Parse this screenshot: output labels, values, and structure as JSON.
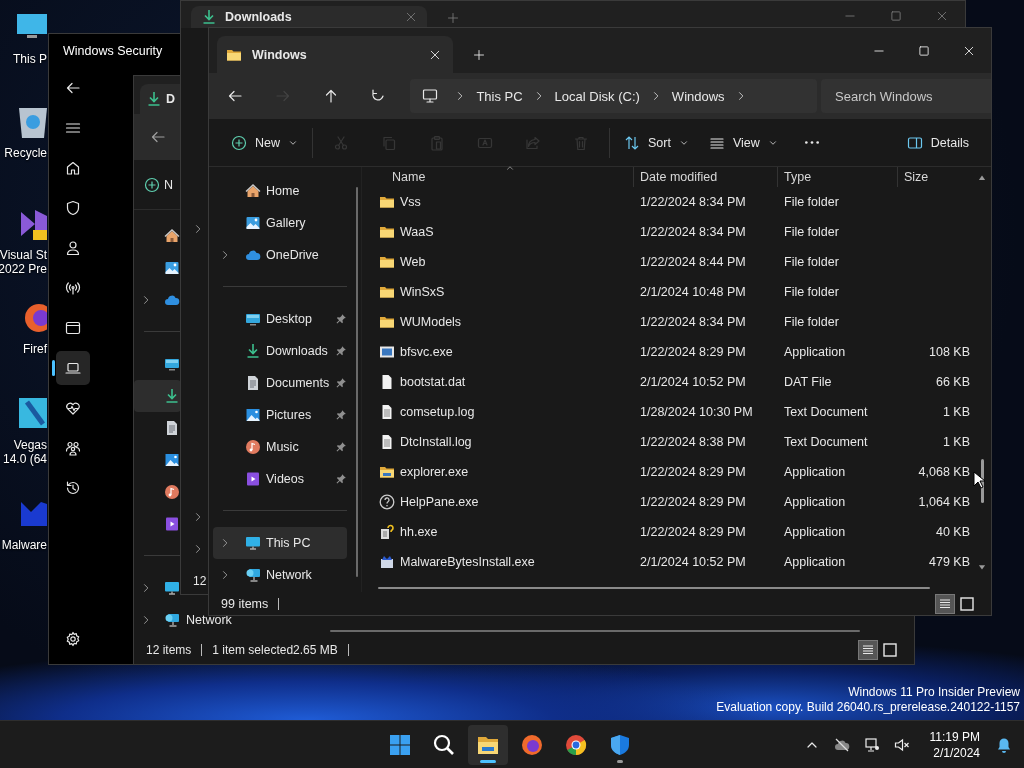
{
  "desktop_icons": [
    {
      "kind": "monitor",
      "lines": [
        "This P"
      ]
    },
    {
      "kind": "recycle",
      "lines": [
        "Recycle"
      ]
    },
    {
      "kind": "ide",
      "lines": [
        "Visual St",
        "2022 Pre"
      ]
    },
    {
      "kind": "firefox",
      "lines": [
        "Firef"
      ]
    },
    {
      "kind": "video",
      "lines": [
        "Vegas",
        "14.0 (64"
      ]
    },
    {
      "kind": "malware",
      "lines": [
        "Malware"
      ]
    }
  ],
  "security_window": {
    "title": "Windows Security",
    "rail": [
      {
        "kind": "back",
        "selected": false
      },
      {
        "kind": "menu",
        "selected": false
      },
      {
        "kind": "home",
        "selected": false
      },
      {
        "kind": "shield",
        "selected": false
      },
      {
        "kind": "person",
        "selected": false
      },
      {
        "kind": "antenna",
        "selected": false
      },
      {
        "kind": "browser",
        "selected": false
      },
      {
        "kind": "laptop",
        "selected": true
      },
      {
        "kind": "heart",
        "selected": false
      },
      {
        "kind": "family",
        "selected": false
      },
      {
        "kind": "history",
        "selected": false
      },
      {
        "kind": "gear",
        "selected": false
      }
    ]
  },
  "downloads_window_front": {
    "tab": "D",
    "new_button": "N",
    "nav": [
      {
        "kind": "home",
        "selected": false
      },
      {
        "kind": "gallery",
        "selected": false
      },
      {
        "kind": "cloud",
        "selected": false,
        "expandable": true
      },
      {
        "kind": "divider"
      },
      {
        "kind": "desktop",
        "selected": false
      },
      {
        "kind": "download",
        "selected": true
      },
      {
        "kind": "documents",
        "selected": false
      },
      {
        "kind": "pictures",
        "selected": false
      },
      {
        "kind": "music",
        "selected": false
      },
      {
        "kind": "videos",
        "selected": false
      },
      {
        "kind": "divider"
      },
      {
        "kind": "thispc",
        "selected": false,
        "expandable": true
      },
      {
        "kind": "network",
        "selected": false,
        "expandable": true,
        "label": "Network"
      }
    ],
    "status": [
      "12 items",
      "1 item selected",
      "2.65 MB"
    ],
    "view_modes": [
      {
        "kind": "details",
        "selected": true
      },
      {
        "kind": "tiles",
        "selected": false
      }
    ]
  },
  "downloads_window_back": {
    "tab": "Downloads",
    "status": "12"
  },
  "explorer": {
    "tab": "Windows",
    "breadcrumb": [
      "This PC",
      "Local Disk (C:)",
      "Windows"
    ],
    "search": {
      "placeholder": "Search Windows"
    },
    "nav_buttons": [
      {
        "kind": "back",
        "disabled": false
      },
      {
        "kind": "forward",
        "disabled": true
      },
      {
        "kind": "up",
        "disabled": false
      },
      {
        "kind": "refresh",
        "disabled": false
      }
    ],
    "commands": [
      {
        "kind": "new",
        "label": "New",
        "disabled": false
      },
      {
        "kind": "cut",
        "disabled": true
      },
      {
        "kind": "copy",
        "disabled": true
      },
      {
        "kind": "paste",
        "disabled": true
      },
      {
        "kind": "rename",
        "disabled": true
      },
      {
        "kind": "share",
        "disabled": true
      },
      {
        "kind": "delete",
        "disabled": true
      },
      {
        "kind": "sort",
        "label": "Sort",
        "disabled": false
      },
      {
        "kind": "view",
        "label": "View",
        "disabled": false
      },
      {
        "kind": "more",
        "disabled": false
      },
      {
        "kind": "details",
        "label": "Details",
        "disabled": false
      }
    ],
    "nav": [
      {
        "kind": "home",
        "label": "Home",
        "selected": false
      },
      {
        "kind": "gallery",
        "label": "Gallery",
        "selected": false
      },
      {
        "kind": "cloud",
        "label": "OneDrive",
        "selected": false,
        "expandable": true
      },
      {
        "kind": "divider"
      },
      {
        "kind": "desktop",
        "label": "Desktop",
        "selected": false,
        "pinned": true
      },
      {
        "kind": "download",
        "label": "Downloads",
        "selected": false,
        "pinned": true
      },
      {
        "kind": "documents",
        "label": "Documents",
        "selected": false,
        "pinned": true
      },
      {
        "kind": "pictures",
        "label": "Pictures",
        "selected": false,
        "pinned": true
      },
      {
        "kind": "music",
        "label": "Music",
        "selected": false,
        "pinned": true
      },
      {
        "kind": "videos",
        "label": "Videos",
        "selected": false,
        "pinned": true
      },
      {
        "kind": "divider"
      },
      {
        "kind": "thispc",
        "label": "This PC",
        "selected": true,
        "expandable": true
      },
      {
        "kind": "network",
        "label": "Network",
        "selected": false,
        "expandable": true
      }
    ],
    "table": {
      "columns": [
        "Name",
        "Date modified",
        "Type",
        "Size"
      ],
      "rows": [
        {
          "kind": "folder",
          "name": "Vss",
          "date": "1/22/2024 8:34 PM",
          "type": "File folder"
        },
        {
          "kind": "folder",
          "name": "WaaS",
          "date": "1/22/2024 8:34 PM",
          "type": "File folder"
        },
        {
          "kind": "folder",
          "name": "Web",
          "date": "1/22/2024 8:44 PM",
          "type": "File folder"
        },
        {
          "kind": "folder",
          "name": "WinSxS",
          "date": "2/1/2024 10:48 PM",
          "type": "File folder"
        },
        {
          "kind": "folder",
          "name": "WUModels",
          "date": "1/22/2024 8:34 PM",
          "type": "File folder"
        },
        {
          "kind": "exe",
          "name": "bfsvc.exe",
          "date": "1/22/2024 8:29 PM",
          "type": "Application",
          "size": "108 KB"
        },
        {
          "kind": "dat",
          "name": "bootstat.dat",
          "date": "2/1/2024 10:52 PM",
          "type": "DAT File",
          "size": "66 KB"
        },
        {
          "kind": "log",
          "name": "comsetup.log",
          "date": "1/28/2024 10:30 PM",
          "type": "Text Document",
          "size": "1 KB"
        },
        {
          "kind": "log",
          "name": "DtcInstall.log",
          "date": "1/22/2024 8:38 PM",
          "type": "Text Document",
          "size": "1 KB"
        },
        {
          "kind": "explorer",
          "name": "explorer.exe",
          "date": "1/22/2024 8:29 PM",
          "type": "Application",
          "size": "4,068 KB"
        },
        {
          "kind": "help",
          "name": "HelpPane.exe",
          "date": "1/22/2024 8:29 PM",
          "type": "Application",
          "size": "1,064 KB"
        },
        {
          "kind": "hh",
          "name": "hh.exe",
          "date": "1/22/2024 8:29 PM",
          "type": "Application",
          "size": "40 KB"
        },
        {
          "kind": "installer",
          "name": "MalwareBytesInstall.exe",
          "date": "2/1/2024 10:52 PM",
          "type": "Application",
          "size": "479 KB"
        }
      ]
    },
    "status": "99 items",
    "view_modes": [
      {
        "kind": "details",
        "selected": true
      },
      {
        "kind": "tiles",
        "selected": false
      }
    ]
  },
  "watermark": [
    "Windows 11 Pro Insider Preview",
    "Evaluation copy. Build 26040.rs_prerelease.240122-1157"
  ],
  "taskbar": {
    "apps": [
      {
        "kind": "start",
        "active": false,
        "running": false
      },
      {
        "kind": "search",
        "active": false,
        "running": false
      },
      {
        "kind": "explorer",
        "active": true,
        "running": true
      },
      {
        "kind": "firefox",
        "active": false,
        "running": false
      },
      {
        "kind": "chrome",
        "active": false,
        "running": false
      },
      {
        "kind": "defender",
        "active": false,
        "running": true
      }
    ],
    "time": "11:19 PM",
    "date": "2/1/2024"
  }
}
